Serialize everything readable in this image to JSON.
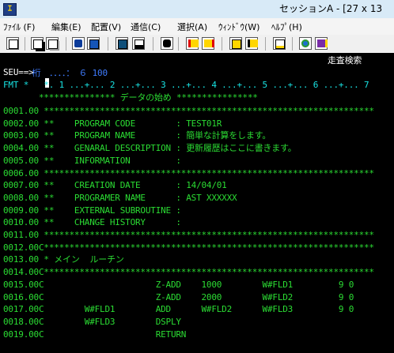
{
  "window": {
    "title": "セッションA - [27 x 13"
  },
  "menu": {
    "items": [
      {
        "label": "ﾌｧｲﾙ (F)"
      },
      {
        "label": "編集(E)"
      },
      {
        "label": "配置(V)"
      },
      {
        "label": "通信(C)"
      },
      {
        "label": "選択(A)"
      },
      {
        "label": "ｳｨﾝﾄﾞｳ(W)"
      },
      {
        "label": "ﾍﾙﾌﾟ(H)"
      }
    ]
  },
  "toolbar": {
    "buttons": [
      {
        "name": "print-screen-icon"
      },
      {
        "name": "copy-icon"
      },
      {
        "name": "paste-icon"
      },
      {
        "name": "send-file-icon"
      },
      {
        "name": "receive-file-icon"
      },
      {
        "name": "display-icon"
      },
      {
        "name": "keyboard-icon"
      },
      {
        "name": "record-macro-icon"
      },
      {
        "name": "stop-macro-icon"
      },
      {
        "name": "play-macro-icon"
      },
      {
        "name": "pause-macro-icon"
      },
      {
        "name": "clipboard-icon"
      },
      {
        "name": "globe-icon"
      },
      {
        "name": "help-book-icon"
      }
    ]
  },
  "terminal": {
    "header": {
      "left": "　桁　．．．．：　６ 100",
      "right": "走査検索",
      "seu_prompt": "SEU==>",
      "fmt": "FMT *   *. 1 ...+... 2 ...+... 3 ...+... 4 ...+... 5 ...+... 6 ...+... 7",
      "data_begin": "       *************** データの始め ****************"
    },
    "lines": [
      {
        "seq": "0001.00",
        "text": " *****************************************************************"
      },
      {
        "seq": "0002.00",
        "text": " **    PROGRAM CODE        : TEST01R"
      },
      {
        "seq": "0003.00",
        "text": " **    PROGRAM NAME        : 簡単な計算をします。"
      },
      {
        "seq": "0004.00",
        "text": " **    GENARAL DESCRIPTION : 更新履歴はここに書きます。"
      },
      {
        "seq": "0005.00",
        "text": " **    INFORMATION         :"
      },
      {
        "seq": "0006.00",
        "text": " *****************************************************************"
      },
      {
        "seq": "0007.00",
        "text": " **    CREATION DATE       : 14/04/01"
      },
      {
        "seq": "0008.00",
        "text": " **    PROGRAMER NAME      : AST XXXXXX"
      },
      {
        "seq": "0009.00",
        "text": " **    EXTERNAL SUBROUTINE :"
      },
      {
        "seq": "0010.00",
        "text": " **    CHANGE HISTORY      :"
      },
      {
        "seq": "0011.00",
        "text": " *****************************************************************"
      },
      {
        "seq": "0012.00",
        "text": "C*****************************************************************"
      },
      {
        "seq": "0013.00",
        "text": " * メイン  ルーチン"
      },
      {
        "seq": "0014.00",
        "text": "C*****************************************************************"
      },
      {
        "seq": "0015.00",
        "text": "C                      Z-ADD    1000        W#FLD1         9 0"
      },
      {
        "seq": "0016.00",
        "text": "C                      Z-ADD    2000        W#FLD2         9 0"
      },
      {
        "seq": "0017.00",
        "text": "C        W#FLD1        ADD      W#FLD2      W#FLD3         9 0"
      },
      {
        "seq": "0018.00",
        "text": "C        W#FLD3        DSPLY"
      },
      {
        "seq": "0019.00",
        "text": "C                      RETURN"
      }
    ]
  }
}
